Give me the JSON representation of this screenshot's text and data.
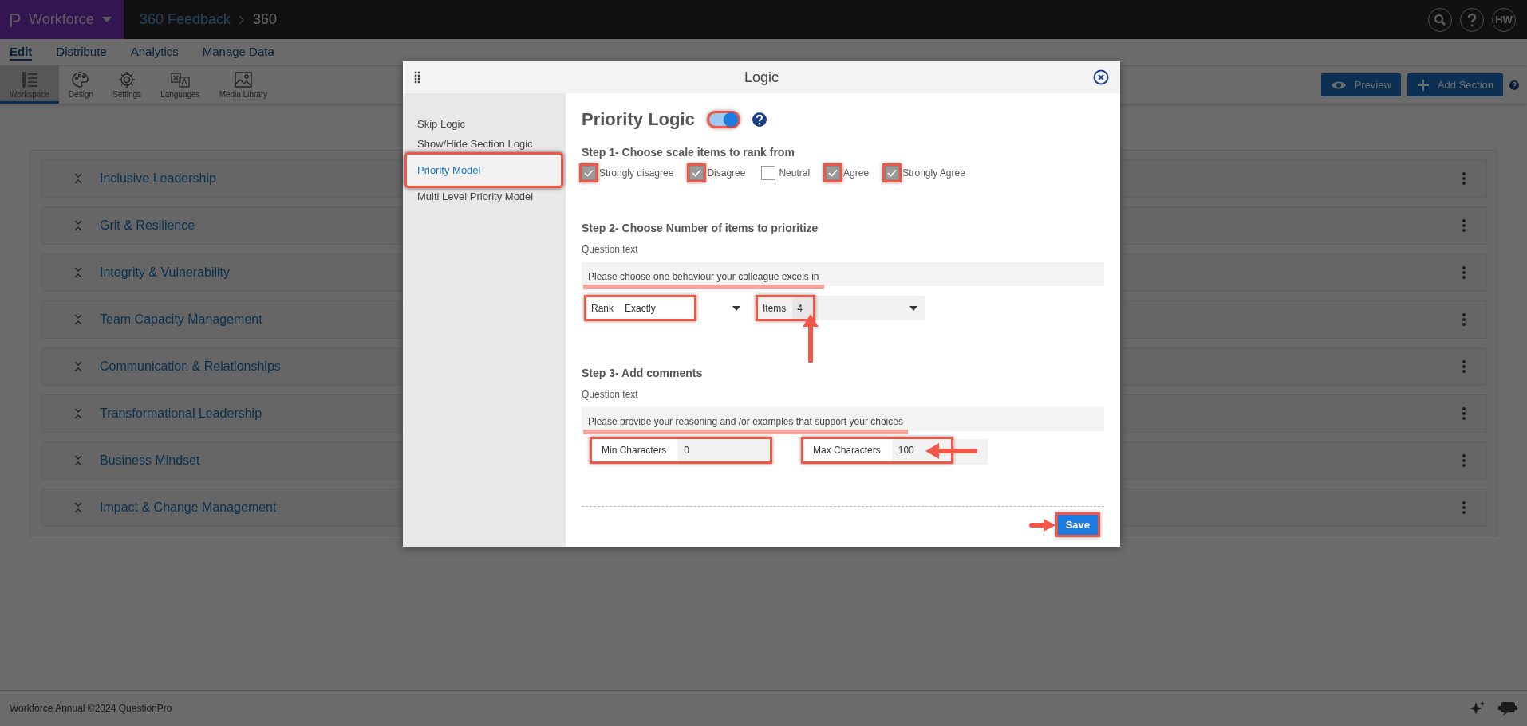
{
  "topbar": {
    "brand": "Workforce",
    "breadcrumb": [
      "360 Feedback",
      "360"
    ],
    "user_initials": "HW"
  },
  "nav_tabs": [
    {
      "label": "Edit",
      "selected": true
    },
    {
      "label": "Distribute",
      "selected": false
    },
    {
      "label": "Analytics",
      "selected": false
    },
    {
      "label": "Manage Data",
      "selected": false
    }
  ],
  "toolbar": [
    {
      "label": "Workspace",
      "kind": "workspace",
      "selected": true
    },
    {
      "label": "Design",
      "kind": "design",
      "selected": false
    },
    {
      "label": "Settings",
      "kind": "settings",
      "selected": false
    },
    {
      "label": "Languages",
      "kind": "languages",
      "selected": false
    },
    {
      "label": "Media Library",
      "kind": "media",
      "selected": false
    }
  ],
  "toolbar_buttons": [
    {
      "label": "Preview",
      "kind": "preview"
    },
    {
      "label": "Add Section",
      "kind": "add"
    }
  ],
  "sections": [
    "Inclusive Leadership",
    "Grit & Resilience",
    "Integrity & Vulnerability",
    "Team Capacity Management",
    "Communication & Relationships",
    "Transformational Leadership",
    "Business Mindset",
    "Impact & Change Management"
  ],
  "footer": "Workforce Annual ©2024 QuestionPro",
  "modal": {
    "title": "Logic",
    "menu": [
      {
        "label": "Skip Logic",
        "selected": false,
        "annotated": false
      },
      {
        "label": "Show/Hide Section Logic",
        "selected": false,
        "annotated": false
      },
      {
        "label": "Priority Model",
        "selected": true,
        "annotated": true
      },
      {
        "label": "Multi Level Priority Model",
        "selected": false,
        "annotated": false
      }
    ],
    "heading": "Priority Logic",
    "toggle": {
      "on": true,
      "annotated": true
    },
    "step1": {
      "title": "Step 1- Choose scale items to rank from",
      "options": [
        {
          "label": "Strongly disagree",
          "checked": true,
          "annotated": true
        },
        {
          "label": "Disagree",
          "checked": true,
          "annotated": true
        },
        {
          "label": "Neutral",
          "checked": false,
          "annotated": false
        },
        {
          "label": "Agree",
          "checked": true,
          "annotated": true
        },
        {
          "label": "Strongly Agree",
          "checked": true,
          "annotated": true
        }
      ]
    },
    "step2": {
      "title": "Step 2- Choose Number of items to prioritize",
      "question_label": "Question text",
      "question": {
        "text": "Please choose one behaviour your colleague excels in",
        "underlined": true
      },
      "rank": {
        "label": "Rank",
        "value": "Exactly",
        "annotated": true
      },
      "items": {
        "label": "Items",
        "value": "4",
        "annotated": true
      }
    },
    "step3": {
      "title": "Step 3- Add comments",
      "question_label": "Question text",
      "question": {
        "text": "Please provide your reasoning and  /or examples that support your choices",
        "underlined": true
      },
      "min": {
        "label": "Min Characters",
        "value": "0",
        "annotated": true
      },
      "max": {
        "label": "Max Characters",
        "value": "100",
        "annotated": true
      }
    },
    "save": {
      "label": "Save",
      "annotated": true
    }
  }
}
